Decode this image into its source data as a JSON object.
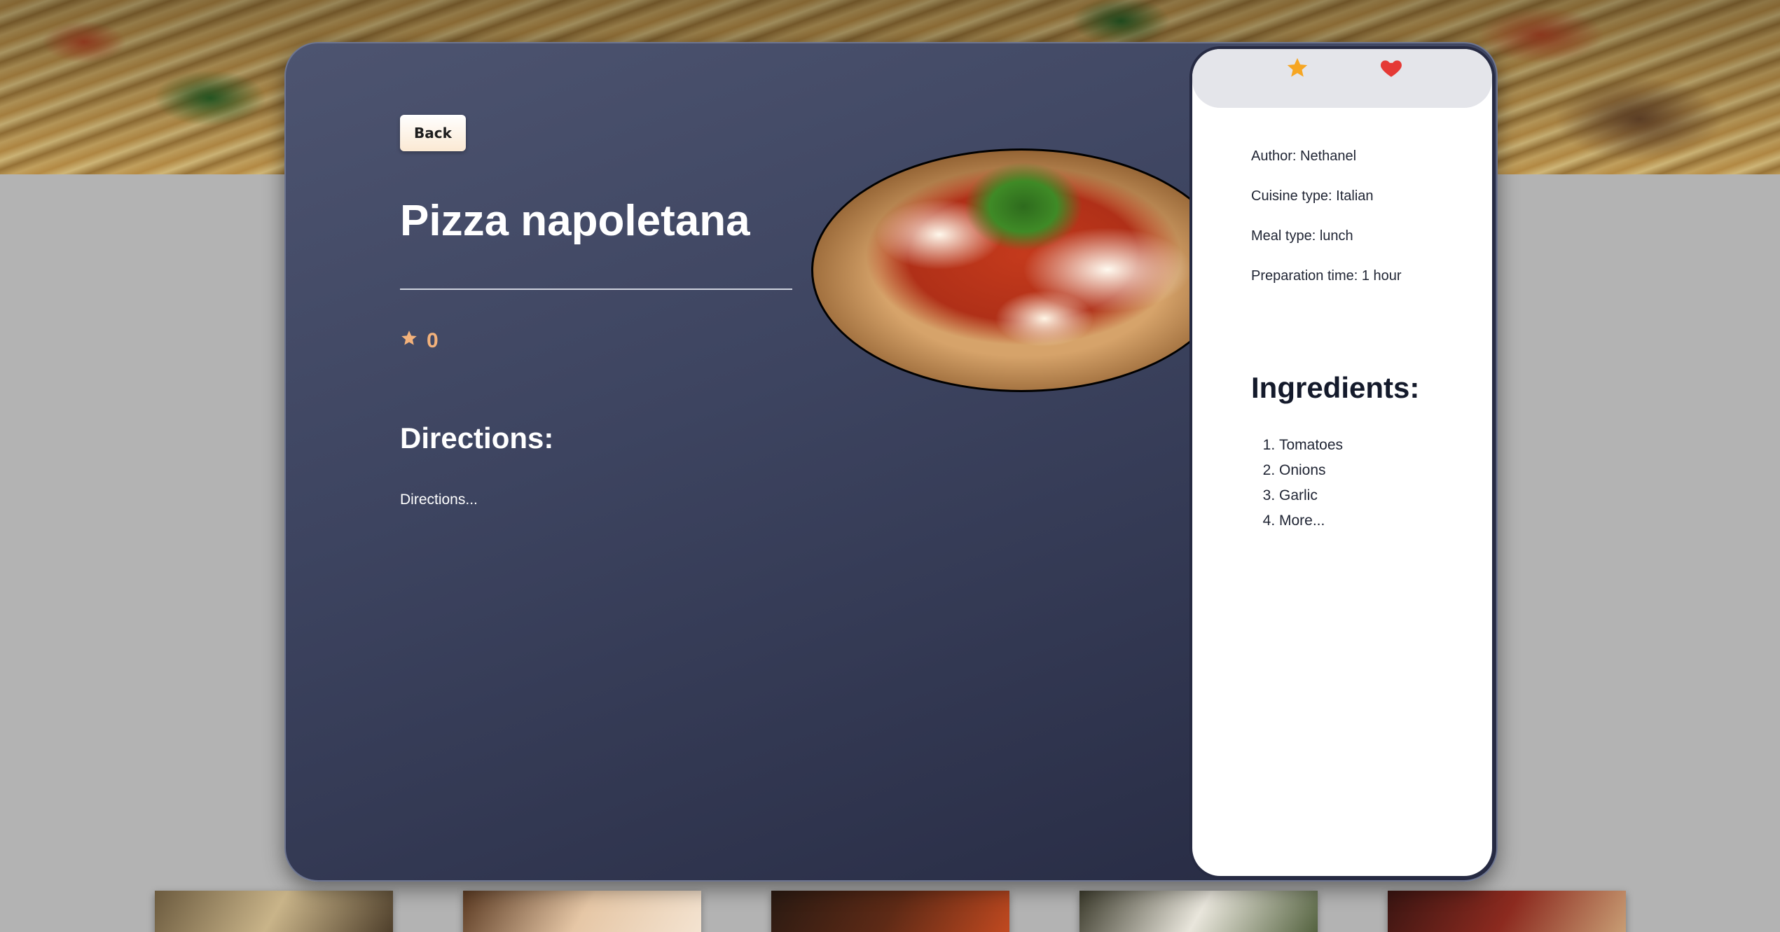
{
  "recipe": {
    "back_label": "Back",
    "title": "Pizza napoletana",
    "rating": "0",
    "directions_heading": "Directions:",
    "directions_text": "Directions...",
    "image_alt": "Pizza napoletana"
  },
  "details": {
    "author": "Author: Nethanel",
    "cuisine": "Cuisine type: Italian",
    "meal": "Meal type: lunch",
    "prep": "Preparation time: 1 hour"
  },
  "ingredients": {
    "heading": "Ingredients:",
    "items": [
      "Tomatoes",
      "Onions",
      "Garlic",
      "More..."
    ]
  },
  "icons": {
    "favorite": "star-icon",
    "like": "heart-icon",
    "rating": "star-icon"
  },
  "colors": {
    "card_top": "#4d5470",
    "card_bottom": "#262a42",
    "rating": "#f3b27b",
    "star": "#f6a623",
    "heart": "#e53935"
  }
}
